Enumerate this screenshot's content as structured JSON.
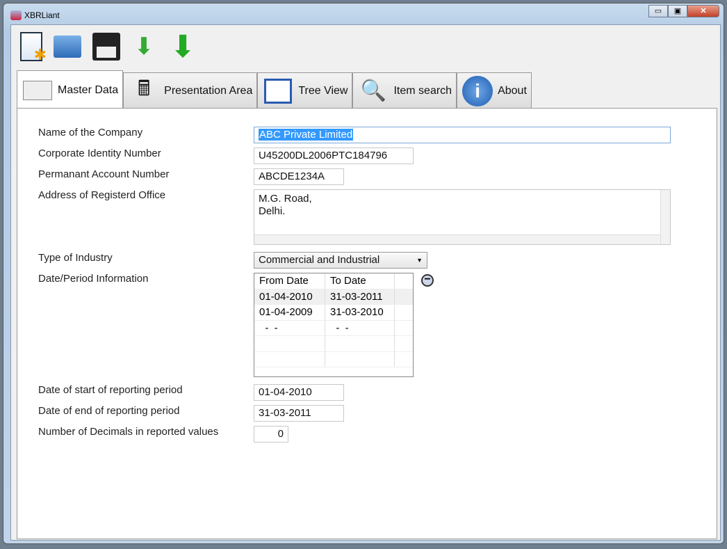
{
  "window": {
    "title": "XBRLiant",
    "minimize": "▭",
    "maximize": "▣",
    "close": "✕"
  },
  "toolbar": [
    {
      "name": "new-icon"
    },
    {
      "name": "open-icon"
    },
    {
      "name": "save-icon"
    },
    {
      "name": "import-icon"
    },
    {
      "name": "download-icon"
    }
  ],
  "tabs": [
    {
      "label": "Master Data"
    },
    {
      "label": "Presentation Area"
    },
    {
      "label": "Tree View"
    },
    {
      "label": "Item search"
    },
    {
      "label": "About"
    }
  ],
  "form": {
    "company_label": "Name of the Company",
    "company": "ABC Private Limited",
    "cin_label": "Corporate Identity Number",
    "cin": "U45200DL2006PTC184796",
    "pan_label": "Permanant Account Number",
    "pan": "ABCDE1234A",
    "address_label": "Address of Registerd Office",
    "address_line1": "M.G. Road,",
    "address_line2": "Delhi.",
    "industry_label": "Type of Industry",
    "industry": "Commercial and Industrial",
    "period_label": "Date/Period Information",
    "periods": {
      "headers": [
        "From Date",
        "To Date"
      ],
      "rows": [
        [
          "01-04-2010",
          "31-03-2011"
        ],
        [
          "01-04-2009",
          "31-03-2010"
        ],
        [
          "  -  -",
          "  -  -"
        ]
      ]
    },
    "start_label": "Date of start of reporting period",
    "start": "01-04-2010",
    "end_label": "Date of end of reporting period",
    "end": "31-03-2011",
    "decimals_label": "Number of Decimals in reported values",
    "decimals": "0"
  }
}
